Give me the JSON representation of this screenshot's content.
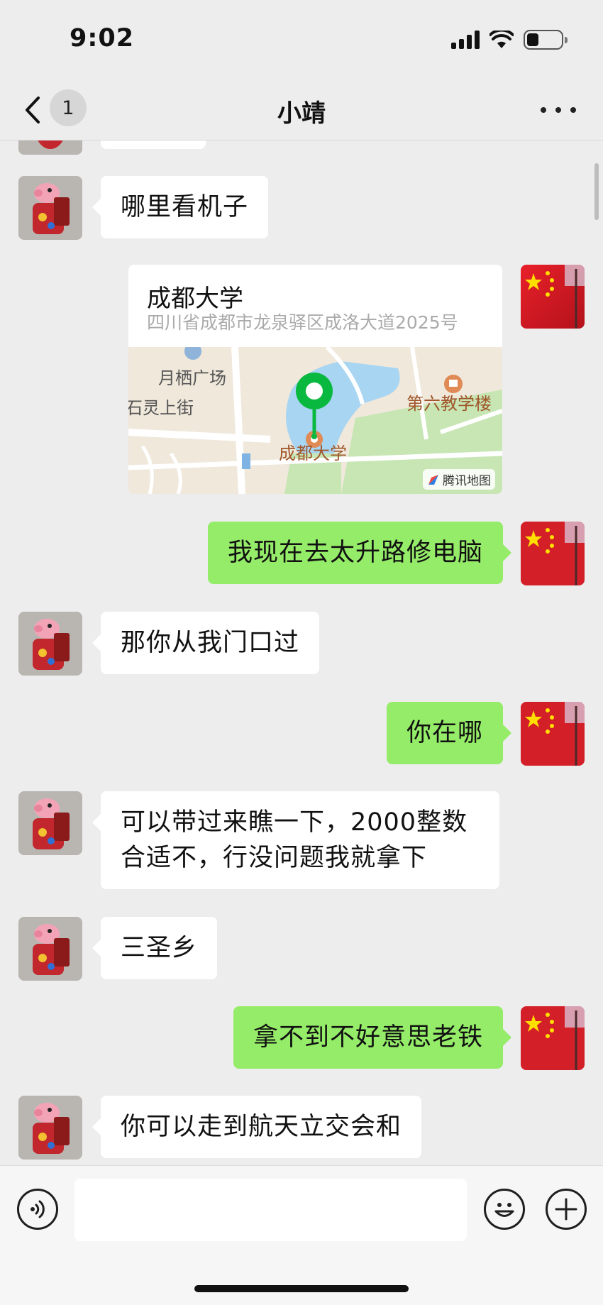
{
  "status_bar": {
    "time": "9:02"
  },
  "nav": {
    "unread_count": "1",
    "title": "小靖"
  },
  "messages": [
    {
      "side": "in",
      "text": "哪里看机子"
    },
    {
      "side": "out",
      "type": "location",
      "location": {
        "name": "成都大学",
        "address": "四川省成都市龙泉驿区成洛大道2025号",
        "map_labels": [
          "月栖广场",
          "石灵上街",
          "第六教学楼",
          "成都大学"
        ],
        "map_credit": "腾讯地图"
      }
    },
    {
      "side": "out",
      "text": "我现在去太升路修电脑"
    },
    {
      "side": "in",
      "text": "那你从我门口过"
    },
    {
      "side": "out",
      "text": "你在哪"
    },
    {
      "side": "in",
      "text": "可以带过来瞧一下，2000整数合适不，行没问题我就拿下"
    },
    {
      "side": "in",
      "text": "三圣乡"
    },
    {
      "side": "out",
      "text": "拿不到不好意思老铁"
    },
    {
      "side": "in",
      "text": "你可以走到航天立交会和"
    }
  ],
  "input": {
    "placeholder": ""
  },
  "colors": {
    "background": "#ededed",
    "outgoing_bubble": "#95ec69",
    "incoming_bubble": "#ffffff",
    "map_pin": "#09b83e"
  },
  "icons": {
    "back": "chevron-left-icon",
    "more": "more-horizontal-icon",
    "voice": "voice-icon",
    "emoji": "emoji-icon",
    "plus": "plus-circle-icon"
  }
}
